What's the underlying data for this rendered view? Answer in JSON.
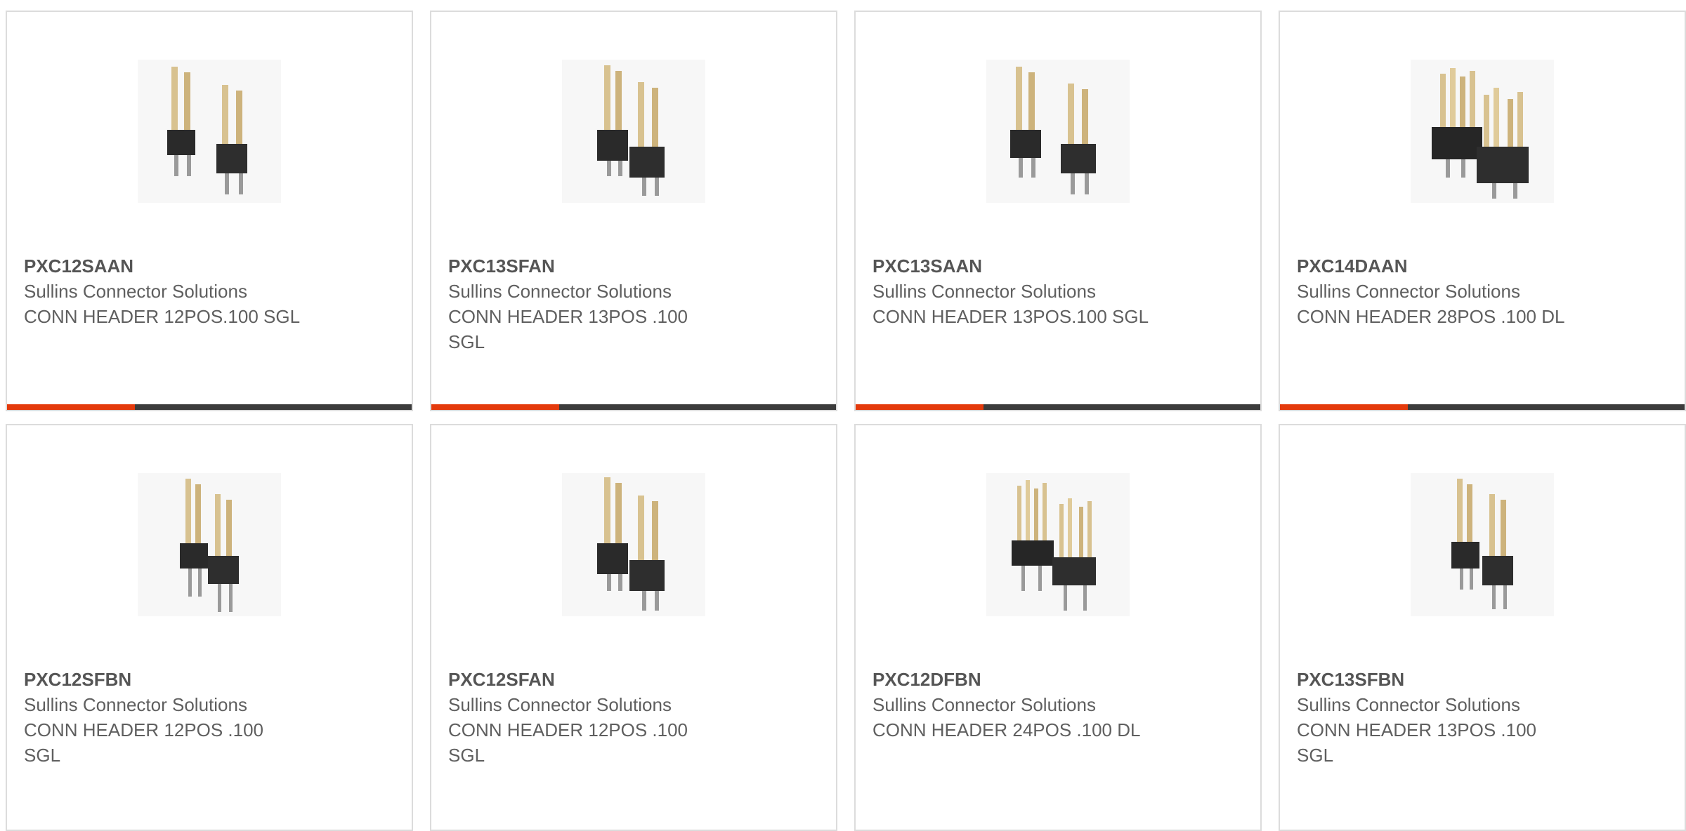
{
  "colors": {
    "accent": "#e43a0c",
    "bar": "#3c3c3c",
    "border": "#dcdcdc",
    "text": "#5f5f5f"
  },
  "products": [
    {
      "part_number": "PXC12SAAN",
      "manufacturer": "Sullins Connector Solutions",
      "description": "CONN HEADER 12POS.100 SGL",
      "image_icon": "pin-header-single-row-icon"
    },
    {
      "part_number": "PXC13SFAN",
      "manufacturer": "Sullins Connector Solutions",
      "description": "CONN HEADER 13POS .100 SGL",
      "image_icon": "pin-header-single-row-icon"
    },
    {
      "part_number": "PXC13SAAN",
      "manufacturer": "Sullins Connector Solutions",
      "description": "CONN HEADER 13POS.100 SGL",
      "image_icon": "pin-header-single-row-icon"
    },
    {
      "part_number": "PXC14DAAN",
      "manufacturer": "Sullins Connector Solutions",
      "description": "CONN HEADER 28POS .100 DL",
      "image_icon": "pin-header-dual-row-icon"
    },
    {
      "part_number": "PXC12SFBN",
      "manufacturer": "Sullins Connector Solutions",
      "description": "CONN HEADER 12POS .100 SGL",
      "image_icon": "pin-header-single-row-icon"
    },
    {
      "part_number": "PXC12SFAN",
      "manufacturer": "Sullins Connector Solutions",
      "description": "CONN HEADER 12POS .100 SGL",
      "image_icon": "pin-header-single-row-icon"
    },
    {
      "part_number": "PXC12DFBN",
      "manufacturer": "Sullins Connector Solutions",
      "description": "CONN HEADER 24POS .100 DL",
      "image_icon": "pin-header-dual-row-icon"
    },
    {
      "part_number": "PXC13SFBN",
      "manufacturer": "Sullins Connector Solutions",
      "description": "CONN HEADER 13POS .100 SGL",
      "image_icon": "pin-header-single-row-icon"
    }
  ]
}
